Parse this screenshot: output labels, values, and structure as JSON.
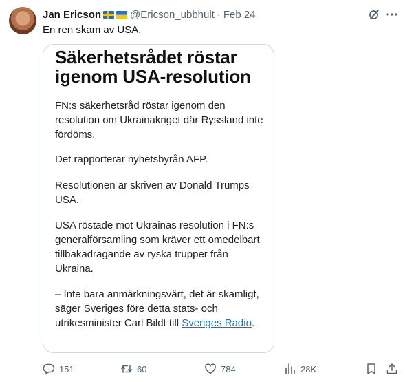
{
  "tweet": {
    "author_name": "Jan Ericson",
    "handle": "@Ericson_ubbhult",
    "separator": "·",
    "date": "Feb 24",
    "text": "En ren skam av USA."
  },
  "card": {
    "headline": "Säkerhetsrådet röstar igenom USA-resolution",
    "paragraphs": [
      "FN:s säkerhetsråd röstar igenom den resolution om Ukrainakriget där Ryssland inte fördöms.",
      "Det rapporterar nyhetsbyrån AFP.",
      "Resolutionen är skriven av Donald Trumps USA.",
      "USA röstade mot Ukrainas resolution i FN:s generalförsamling som kräver ett omedelbart tillbakadragande av ryska trupper från Ukraina."
    ],
    "last_paragraph": "– Inte bara anmärkningsvärt, det är skamligt, säger Sveriges före detta stats- och utrikesminister Carl Bildt till ",
    "link_text": "Sveriges Radio",
    "last_period": "."
  },
  "actions": {
    "replies": "151",
    "reposts": "60",
    "likes": "784",
    "views": "28K"
  },
  "icons": {
    "header": [
      "grok-icon",
      "more-icon"
    ],
    "actions": [
      "reply-icon",
      "repost-icon",
      "like-icon",
      "views-icon",
      "bookmark-icon",
      "share-icon"
    ],
    "flags": [
      "sweden-flag-icon",
      "ukraine-flag-icon"
    ]
  },
  "colors": {
    "text": "#0f1419",
    "secondary": "#536471",
    "border": "#cfd9de",
    "link": "#1a73c0"
  }
}
